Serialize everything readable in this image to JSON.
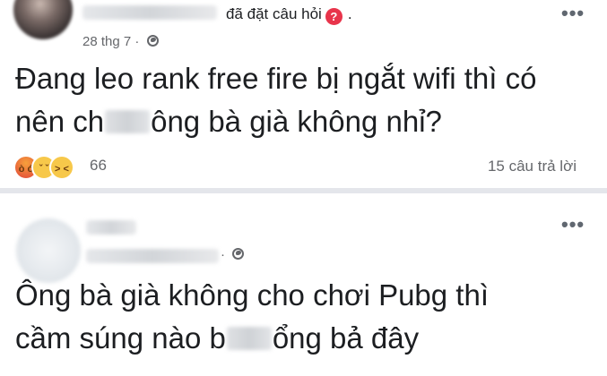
{
  "post1": {
    "header_action": "đã đặt câu hỏi",
    "question_badge": "?",
    "header_dot": ".",
    "date": "28 thg 7",
    "date_sep": "·",
    "more": "•••",
    "body_lines": [
      "Đang leo rank free fire bị ngắt wifi thì có",
      "nên ch",
      "ông bà già không nhỉ?"
    ],
    "reaction_count": "66",
    "answers": "15 câu trả lời",
    "reactions": [
      "angry-reaction-icon",
      "sad-reaction-icon",
      "haha-reaction-icon"
    ]
  },
  "post2": {
    "more": "•••",
    "body_lines": [
      "Ông bà già không cho chơi Pubg thì",
      "cầm súng nào b",
      "ổng bả đây"
    ]
  },
  "colors": {
    "text": "#1c1e21",
    "meta": "#65676b",
    "badge": "#e8344b",
    "divider": "#e4e6eb"
  }
}
